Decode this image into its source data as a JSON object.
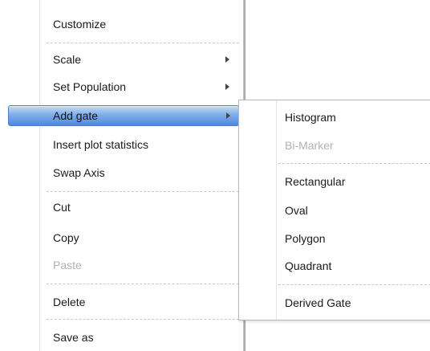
{
  "context_menu": {
    "items": [
      {
        "label": "Customize"
      },
      {
        "label": "Scale"
      },
      {
        "label": "Set Population"
      },
      {
        "label": "Add gate"
      },
      {
        "label": "Insert plot statistics"
      },
      {
        "label": "Swap Axis"
      },
      {
        "label": "Cut"
      },
      {
        "label": "Copy"
      },
      {
        "label": "Paste",
        "state": "disabled"
      },
      {
        "label": "Delete"
      },
      {
        "label": "Save as"
      }
    ]
  },
  "submenu": {
    "parent": "Add gate",
    "items": [
      {
        "label": "Histogram"
      },
      {
        "label": "Bi-Marker",
        "state": "disabled"
      },
      {
        "label": "Rectangular"
      },
      {
        "label": "Oval"
      },
      {
        "label": "Polygon"
      },
      {
        "label": "Quadrant"
      },
      {
        "label": "Derived Gate"
      }
    ]
  },
  "colors": {
    "highlight_top": "#c6ddf7",
    "highlight_bottom": "#4f88dd",
    "disabled_text": "#b2b2b2"
  }
}
